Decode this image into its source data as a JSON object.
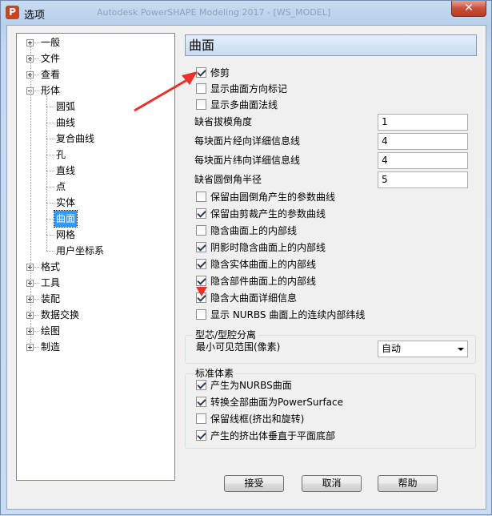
{
  "window": {
    "title": "选项",
    "app_icon_letter": "P",
    "background_title": "Autodesk PowerSHAPE Modeling 2017 - [WS_MODEL]"
  },
  "tree": {
    "items": [
      {
        "label": "一般",
        "expander": "plus"
      },
      {
        "label": "文件",
        "expander": "plus"
      },
      {
        "label": "查看",
        "expander": "plus"
      },
      {
        "label": "形体",
        "expander": "minus"
      },
      {
        "label": "圆弧"
      },
      {
        "label": "曲线"
      },
      {
        "label": "复合曲线"
      },
      {
        "label": "孔"
      },
      {
        "label": "直线"
      },
      {
        "label": "点"
      },
      {
        "label": "实体"
      },
      {
        "label": "曲面",
        "selected": true
      },
      {
        "label": "网格"
      },
      {
        "label": "用户坐标系"
      },
      {
        "label": "格式",
        "expander": "plus"
      },
      {
        "label": "工具",
        "expander": "plus"
      },
      {
        "label": "装配",
        "expander": "plus"
      },
      {
        "label": "数据交换",
        "expander": "plus"
      },
      {
        "label": "绘图",
        "expander": "plus"
      },
      {
        "label": "制造",
        "expander": "plus"
      }
    ]
  },
  "panel": {
    "title": "曲面",
    "top_checks": [
      {
        "label": "修剪",
        "checked": true
      },
      {
        "label": "显示曲面方向标记",
        "checked": false
      },
      {
        "label": "显示多曲面法线",
        "checked": false
      }
    ],
    "fields": [
      {
        "label": "缺省拔模角度",
        "value": "1"
      },
      {
        "label": "每块面片经向详细信息线",
        "value": "4"
      },
      {
        "label": "每块面片纬向详细信息线",
        "value": "4"
      },
      {
        "label": "缺省圆倒角半径",
        "value": "5"
      }
    ],
    "mid_checks": [
      {
        "label": "保留由圆倒角产生的参数曲线",
        "checked": false
      },
      {
        "label": "保留由剪裁产生的参数曲线",
        "checked": true
      },
      {
        "label": "隐含曲面上的内部线",
        "checked": false
      },
      {
        "label": "阴影时隐含曲面上的内部线",
        "checked": true
      },
      {
        "label": "隐含实体曲面上的内部线",
        "checked": true
      },
      {
        "label": "隐含部件曲面上的内部线",
        "checked": true
      },
      {
        "label": "隐含大曲面详细信息",
        "checked": true
      },
      {
        "label": "显示 NURBS 曲面上的连续内部纬线",
        "checked": false
      }
    ],
    "core_cavity": {
      "title": "型芯/型腔分离",
      "label": "最小可见范围(像素)",
      "selected": "自动"
    },
    "standard_primitives": {
      "title": "标准体素",
      "checks": [
        {
          "label": "产生为NURBS曲面",
          "checked": true
        },
        {
          "label": "转换全部曲面为PowerSurface",
          "checked": true
        },
        {
          "label": "保留线框(挤出和旋转)",
          "checked": false
        },
        {
          "label": "产生的挤出体垂直于平面底部",
          "checked": true
        }
      ]
    }
  },
  "buttons": {
    "accept": "接受",
    "cancel": "取消",
    "help": "帮助"
  },
  "colors": {
    "selection": "#3399ff",
    "annotation_arrow": "#e8322a"
  }
}
